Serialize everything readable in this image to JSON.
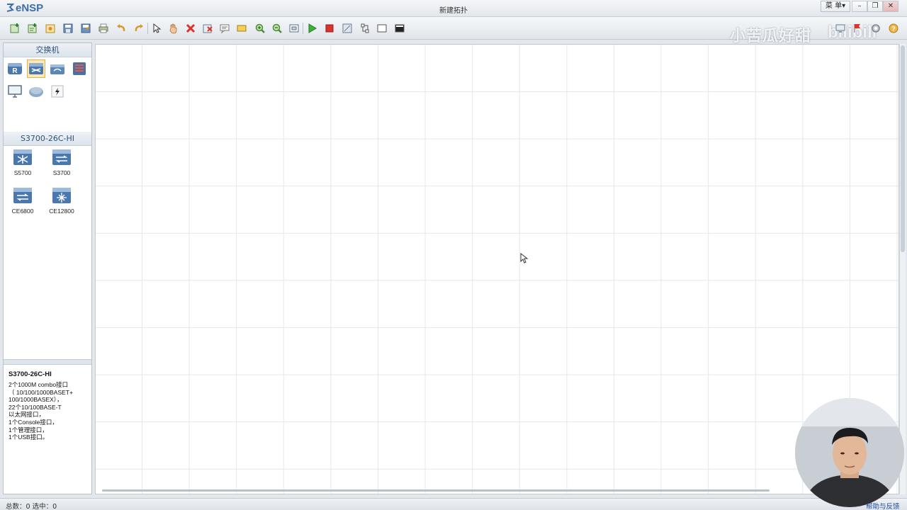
{
  "window": {
    "app_name": "eNSP",
    "title": "新建拓扑",
    "menu_label": "菜 单▾"
  },
  "toolbar": {
    "buttons": [
      "new-topology",
      "new-exam",
      "open",
      "save",
      "save-as",
      "print",
      "undo",
      "redo",
      "select",
      "pan",
      "delete",
      "delete-all",
      "text",
      "rectangle",
      "zoom-in",
      "zoom-out",
      "fit",
      "start-device",
      "stop-device",
      "capture",
      "topology-view",
      "display-grid",
      "terminal"
    ],
    "right_buttons": [
      "screen-icon",
      "flag-icon",
      "settings-icon",
      "help-icon"
    ],
    "watermark": "小苦瓜好甜",
    "bili_mark": "bilibili"
  },
  "left_panel": {
    "category_header": "交换机",
    "categories": [
      {
        "name": "router-icon",
        "selected": false
      },
      {
        "name": "switch-icon",
        "selected": true
      },
      {
        "name": "wireless-icon",
        "selected": false
      },
      {
        "name": "firewall-icon",
        "selected": false
      },
      {
        "name": "pc-icon",
        "selected": false
      },
      {
        "name": "cloud-icon",
        "selected": false
      },
      {
        "name": "connection-icon",
        "selected": false
      }
    ],
    "device_header": "S3700-26C-HI",
    "devices": [
      {
        "label": "S5700"
      },
      {
        "label": "S3700"
      },
      {
        "label": "CE6800"
      },
      {
        "label": "CE12800"
      }
    ],
    "description": {
      "title": "S3700-26C-HI",
      "lines": [
        "2个1000M combo接口",
        "（ 10/100/1000BASET+",
        "100/1000BASEX），",
        "22个10/100BASE-T",
        "以太网接口，",
        "1个Console接口，",
        "1个管理接口，",
        "1个USB接口。"
      ]
    }
  },
  "status_bar": {
    "text": "总数：0 选中：0",
    "feedback": "帮助与反馈"
  },
  "colors": {
    "accent": "#3d6fa8",
    "panel_header": "#2f4f7a",
    "grid": "#e4e8ec"
  }
}
